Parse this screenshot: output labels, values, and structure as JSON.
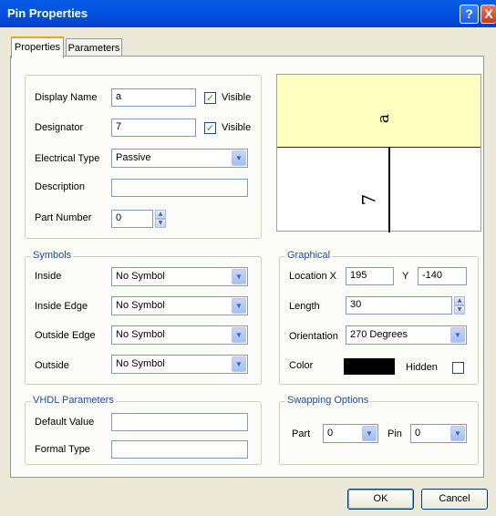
{
  "window": {
    "title": "Pin Properties",
    "help_label": "?",
    "close_label": "X"
  },
  "tabs": [
    {
      "label": "Properties"
    },
    {
      "label": "Parameters"
    }
  ],
  "properties": {
    "display_name": {
      "label": "Display Name",
      "value": "a",
      "visible_label": "Visible",
      "visible": true
    },
    "designator": {
      "label": "Designator",
      "value": "7",
      "visible_label": "Visible",
      "visible": true
    },
    "electrical_type": {
      "label": "Electrical Type",
      "value": "Passive"
    },
    "description": {
      "label": "Description",
      "value": ""
    },
    "part_number": {
      "label": "Part Number",
      "value": "0"
    }
  },
  "preview": {
    "name_text": "a",
    "designator_text": "7",
    "name_bg": "#ffffc0",
    "body_bg": "#ffffff",
    "line_color": "#7f0000"
  },
  "symbols": {
    "title": "Symbols",
    "inside": {
      "label": "Inside",
      "value": "No Symbol"
    },
    "inside_edge": {
      "label": "Inside Edge",
      "value": "No Symbol"
    },
    "outside_edge": {
      "label": "Outside Edge",
      "value": "No Symbol"
    },
    "outside": {
      "label": "Outside",
      "value": "No Symbol"
    }
  },
  "graphical": {
    "title": "Graphical",
    "location_label": "Location X",
    "x": "195",
    "y_label": "Y",
    "y": "-140",
    "length_label": "Length",
    "length": "30",
    "orientation_label": "Orientation",
    "orientation": "270 Degrees",
    "color_label": "Color",
    "color": "#000000",
    "hidden_label": "Hidden",
    "hidden": false
  },
  "vhdl": {
    "title": "VHDL Parameters",
    "default_value": {
      "label": "Default Value",
      "value": ""
    },
    "formal_type": {
      "label": "Formal Type",
      "value": ""
    }
  },
  "swapping": {
    "title": "Swapping Options",
    "part_label": "Part",
    "part": "0",
    "pin_label": "Pin",
    "pin": "0"
  },
  "buttons": {
    "ok": "OK",
    "cancel": "Cancel"
  }
}
